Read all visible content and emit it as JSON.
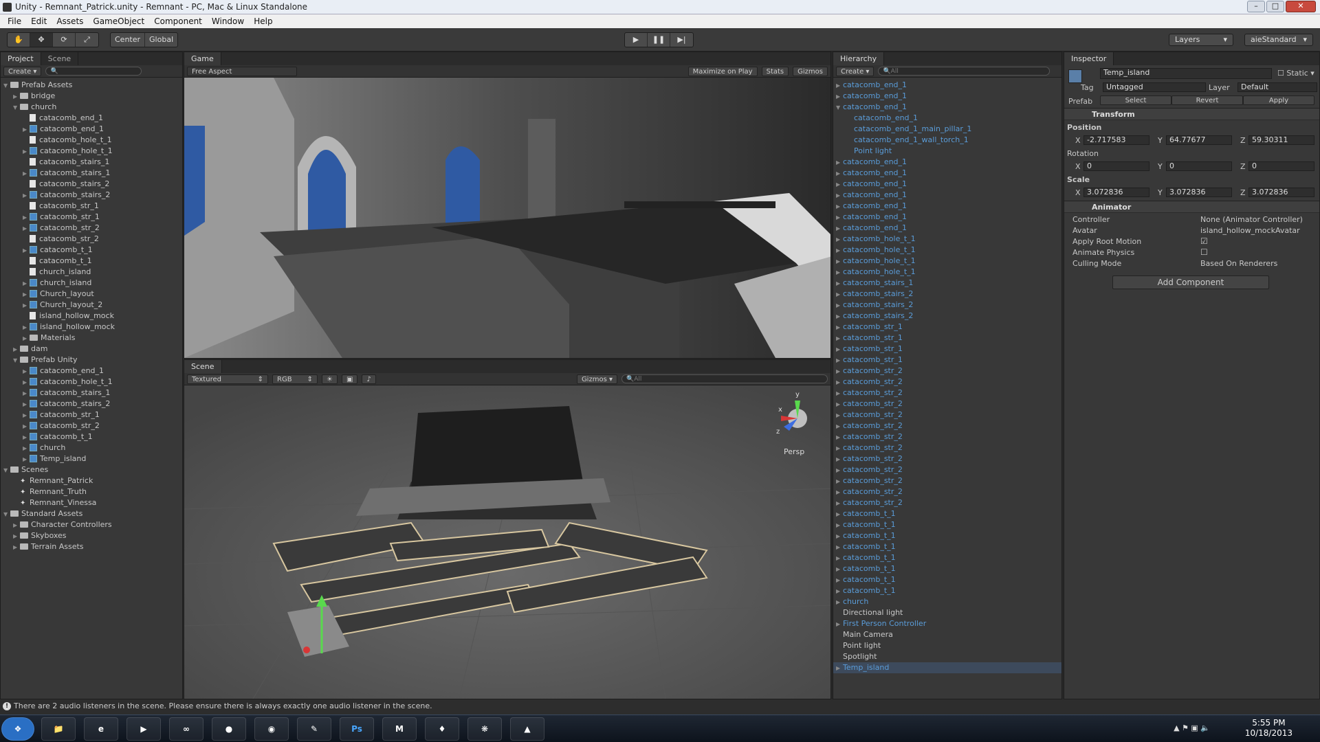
{
  "window": {
    "title": "Unity - Remnant_Patrick.unity - Remnant - PC, Mac & Linux Standalone"
  },
  "menu": [
    "File",
    "Edit",
    "Assets",
    "GameObject",
    "Component",
    "Window",
    "Help"
  ],
  "toolbar": {
    "tools": [
      "hand-tool",
      "move-tool",
      "rotate-tool",
      "scale-tool"
    ],
    "pivot": "Center",
    "space": "Global",
    "layers": "Layers",
    "layout": "aieStandard"
  },
  "project": {
    "tab_label": "Project",
    "scene_tab_label": "Scene",
    "create": "Create",
    "items": [
      {
        "label": "Prefab Assets",
        "depth": 0,
        "kind": "folder",
        "arrow": "down"
      },
      {
        "label": "bridge",
        "depth": 1,
        "kind": "folder",
        "arrow": "right"
      },
      {
        "label": "church",
        "depth": 1,
        "kind": "folder",
        "arrow": "down"
      },
      {
        "label": "catacomb_end_1",
        "depth": 2,
        "kind": "white",
        "arrow": ""
      },
      {
        "label": "catacomb_end_1",
        "depth": 2,
        "kind": "prefab",
        "arrow": "right"
      },
      {
        "label": "catacomb_hole_t_1",
        "depth": 2,
        "kind": "white",
        "arrow": ""
      },
      {
        "label": "catacomb_hole_t_1",
        "depth": 2,
        "kind": "prefab",
        "arrow": "right"
      },
      {
        "label": "catacomb_stairs_1",
        "depth": 2,
        "kind": "white",
        "arrow": ""
      },
      {
        "label": "catacomb_stairs_1",
        "depth": 2,
        "kind": "prefab",
        "arrow": "right"
      },
      {
        "label": "catacomb_stairs_2",
        "depth": 2,
        "kind": "white",
        "arrow": ""
      },
      {
        "label": "catacomb_stairs_2",
        "depth": 2,
        "kind": "prefab",
        "arrow": "right"
      },
      {
        "label": "catacomb_str_1",
        "depth": 2,
        "kind": "white",
        "arrow": ""
      },
      {
        "label": "catacomb_str_1",
        "depth": 2,
        "kind": "prefab",
        "arrow": "right"
      },
      {
        "label": "catacomb_str_2",
        "depth": 2,
        "kind": "prefab",
        "arrow": "right"
      },
      {
        "label": "catacomb_str_2",
        "depth": 2,
        "kind": "white",
        "arrow": ""
      },
      {
        "label": "catacomb_t_1",
        "depth": 2,
        "kind": "prefab",
        "arrow": "right"
      },
      {
        "label": "catacomb_t_1",
        "depth": 2,
        "kind": "white",
        "arrow": ""
      },
      {
        "label": "church_island",
        "depth": 2,
        "kind": "white",
        "arrow": ""
      },
      {
        "label": "church_island",
        "depth": 2,
        "kind": "prefab",
        "arrow": "right"
      },
      {
        "label": "Church_layout",
        "depth": 2,
        "kind": "prefab",
        "arrow": "right"
      },
      {
        "label": "Church_layout_2",
        "depth": 2,
        "kind": "prefab",
        "arrow": "right"
      },
      {
        "label": "island_hollow_mock",
        "depth": 2,
        "kind": "white",
        "arrow": ""
      },
      {
        "label": "island_hollow_mock",
        "depth": 2,
        "kind": "prefab",
        "arrow": "right"
      },
      {
        "label": "Materials",
        "depth": 2,
        "kind": "folder",
        "arrow": "right"
      },
      {
        "label": "dam",
        "depth": 1,
        "kind": "folder",
        "arrow": "right"
      },
      {
        "label": "Prefab Unity",
        "depth": 1,
        "kind": "folder",
        "arrow": "down"
      },
      {
        "label": "catacomb_end_1",
        "depth": 2,
        "kind": "prefab",
        "arrow": "right"
      },
      {
        "label": "catacomb_hole_t_1",
        "depth": 2,
        "kind": "prefab",
        "arrow": "right"
      },
      {
        "label": "catacomb_stairs_1",
        "depth": 2,
        "kind": "prefab",
        "arrow": "right"
      },
      {
        "label": "catacomb_stairs_2",
        "depth": 2,
        "kind": "prefab",
        "arrow": "right"
      },
      {
        "label": "catacomb_str_1",
        "depth": 2,
        "kind": "prefab",
        "arrow": "right"
      },
      {
        "label": "catacomb_str_2",
        "depth": 2,
        "kind": "prefab",
        "arrow": "right"
      },
      {
        "label": "catacomb_t_1",
        "depth": 2,
        "kind": "prefab",
        "arrow": "right"
      },
      {
        "label": "church",
        "depth": 2,
        "kind": "prefab",
        "arrow": "right"
      },
      {
        "label": "Temp_island",
        "depth": 2,
        "kind": "prefab",
        "arrow": "right"
      },
      {
        "label": "Scenes",
        "depth": 0,
        "kind": "folder",
        "arrow": "down"
      },
      {
        "label": "Remnant_Patrick",
        "depth": 1,
        "kind": "scene",
        "arrow": ""
      },
      {
        "label": "Remnant_Truth",
        "depth": 1,
        "kind": "scene",
        "arrow": ""
      },
      {
        "label": "Remnant_Vinessa",
        "depth": 1,
        "kind": "scene",
        "arrow": ""
      },
      {
        "label": "Standard Assets",
        "depth": 0,
        "kind": "folder",
        "arrow": "down"
      },
      {
        "label": "Character Controllers",
        "depth": 1,
        "kind": "folder",
        "arrow": "right"
      },
      {
        "label": "Skyboxes",
        "depth": 1,
        "kind": "folder",
        "arrow": "right"
      },
      {
        "label": "Terrain Assets",
        "depth": 1,
        "kind": "folder",
        "arrow": "right"
      }
    ]
  },
  "game": {
    "tab_label": "Game",
    "aspect": "Free Aspect",
    "maximize": "Maximize on Play",
    "stats": "Stats",
    "gizmos": "Gizmos"
  },
  "scene": {
    "tab_label": "Scene",
    "shading": "Textured",
    "render_mode": "RGB",
    "gizmos": "Gizmos",
    "search": "All",
    "persp": "Persp",
    "axis_y": "y",
    "axis_x": "x",
    "axis_z": "z"
  },
  "hierarchy": {
    "tab_label": "Hierarchy",
    "create": "Create",
    "search": "All",
    "items": [
      {
        "label": "catacomb_end_1",
        "depth": 0,
        "arrow": "right",
        "style": "prefab"
      },
      {
        "label": "catacomb_end_1",
        "depth": 0,
        "arrow": "right",
        "style": "prefab"
      },
      {
        "label": "catacomb_end_1",
        "depth": 0,
        "arrow": "down",
        "style": "prefab"
      },
      {
        "label": "catacomb_end_1",
        "depth": 1,
        "arrow": "",
        "style": "prefab"
      },
      {
        "label": "catacomb_end_1_main_pillar_1",
        "depth": 1,
        "arrow": "",
        "style": "prefab"
      },
      {
        "label": "catacomb_end_1_wall_torch_1",
        "depth": 1,
        "arrow": "",
        "style": "prefab"
      },
      {
        "label": "Point light",
        "depth": 1,
        "arrow": "",
        "style": "prefab"
      },
      {
        "label": "catacomb_end_1",
        "depth": 0,
        "arrow": "right",
        "style": "prefab"
      },
      {
        "label": "catacomb_end_1",
        "depth": 0,
        "arrow": "right",
        "style": "prefab"
      },
      {
        "label": "catacomb_end_1",
        "depth": 0,
        "arrow": "right",
        "style": "prefab"
      },
      {
        "label": "catacomb_end_1",
        "depth": 0,
        "arrow": "right",
        "style": "prefab"
      },
      {
        "label": "catacomb_end_1",
        "depth": 0,
        "arrow": "right",
        "style": "prefab"
      },
      {
        "label": "catacomb_end_1",
        "depth": 0,
        "arrow": "right",
        "style": "prefab"
      },
      {
        "label": "catacomb_end_1",
        "depth": 0,
        "arrow": "right",
        "style": "prefab"
      },
      {
        "label": "catacomb_hole_t_1",
        "depth": 0,
        "arrow": "right",
        "style": "prefab"
      },
      {
        "label": "catacomb_hole_t_1",
        "depth": 0,
        "arrow": "right",
        "style": "prefab"
      },
      {
        "label": "catacomb_hole_t_1",
        "depth": 0,
        "arrow": "right",
        "style": "prefab"
      },
      {
        "label": "catacomb_hole_t_1",
        "depth": 0,
        "arrow": "right",
        "style": "prefab"
      },
      {
        "label": "catacomb_stairs_1",
        "depth": 0,
        "arrow": "right",
        "style": "prefab"
      },
      {
        "label": "catacomb_stairs_2",
        "depth": 0,
        "arrow": "right",
        "style": "prefab"
      },
      {
        "label": "catacomb_stairs_2",
        "depth": 0,
        "arrow": "right",
        "style": "prefab"
      },
      {
        "label": "catacomb_stairs_2",
        "depth": 0,
        "arrow": "right",
        "style": "prefab"
      },
      {
        "label": "catacomb_str_1",
        "depth": 0,
        "arrow": "right",
        "style": "prefab"
      },
      {
        "label": "catacomb_str_1",
        "depth": 0,
        "arrow": "right",
        "style": "prefab"
      },
      {
        "label": "catacomb_str_1",
        "depth": 0,
        "arrow": "right",
        "style": "prefab"
      },
      {
        "label": "catacomb_str_1",
        "depth": 0,
        "arrow": "right",
        "style": "prefab"
      },
      {
        "label": "catacomb_str_2",
        "depth": 0,
        "arrow": "right",
        "style": "prefab"
      },
      {
        "label": "catacomb_str_2",
        "depth": 0,
        "arrow": "right",
        "style": "prefab"
      },
      {
        "label": "catacomb_str_2",
        "depth": 0,
        "arrow": "right",
        "style": "prefab"
      },
      {
        "label": "catacomb_str_2",
        "depth": 0,
        "arrow": "right",
        "style": "prefab"
      },
      {
        "label": "catacomb_str_2",
        "depth": 0,
        "arrow": "right",
        "style": "prefab"
      },
      {
        "label": "catacomb_str_2",
        "depth": 0,
        "arrow": "right",
        "style": "prefab"
      },
      {
        "label": "catacomb_str_2",
        "depth": 0,
        "arrow": "right",
        "style": "prefab"
      },
      {
        "label": "catacomb_str_2",
        "depth": 0,
        "arrow": "right",
        "style": "prefab"
      },
      {
        "label": "catacomb_str_2",
        "depth": 0,
        "arrow": "right",
        "style": "prefab"
      },
      {
        "label": "catacomb_str_2",
        "depth": 0,
        "arrow": "right",
        "style": "prefab"
      },
      {
        "label": "catacomb_str_2",
        "depth": 0,
        "arrow": "right",
        "style": "prefab"
      },
      {
        "label": "catacomb_str_2",
        "depth": 0,
        "arrow": "right",
        "style": "prefab"
      },
      {
        "label": "catacomb_str_2",
        "depth": 0,
        "arrow": "right",
        "style": "prefab"
      },
      {
        "label": "catacomb_t_1",
        "depth": 0,
        "arrow": "right",
        "style": "prefab"
      },
      {
        "label": "catacomb_t_1",
        "depth": 0,
        "arrow": "right",
        "style": "prefab"
      },
      {
        "label": "catacomb_t_1",
        "depth": 0,
        "arrow": "right",
        "style": "prefab"
      },
      {
        "label": "catacomb_t_1",
        "depth": 0,
        "arrow": "right",
        "style": "prefab"
      },
      {
        "label": "catacomb_t_1",
        "depth": 0,
        "arrow": "right",
        "style": "prefab"
      },
      {
        "label": "catacomb_t_1",
        "depth": 0,
        "arrow": "right",
        "style": "prefab"
      },
      {
        "label": "catacomb_t_1",
        "depth": 0,
        "arrow": "right",
        "style": "prefab"
      },
      {
        "label": "catacomb_t_1",
        "depth": 0,
        "arrow": "right",
        "style": "prefab"
      },
      {
        "label": "church",
        "depth": 0,
        "arrow": "right",
        "style": "prefab"
      },
      {
        "label": "Directional light",
        "depth": 0,
        "arrow": "",
        "style": "plain"
      },
      {
        "label": "First Person Controller",
        "depth": 0,
        "arrow": "right",
        "style": "prefab"
      },
      {
        "label": "Main Camera",
        "depth": 0,
        "arrow": "",
        "style": "plain"
      },
      {
        "label": "Point light",
        "depth": 0,
        "arrow": "",
        "style": "plain"
      },
      {
        "label": "Spotlight",
        "depth": 0,
        "arrow": "",
        "style": "plain"
      },
      {
        "label": "Temp_island",
        "depth": 0,
        "arrow": "right",
        "style": "selected"
      }
    ]
  },
  "inspector": {
    "tab_label": "Inspector",
    "object_name": "Temp_island",
    "static_label": "Static",
    "tag_label": "Tag",
    "tag_value": "Untagged",
    "layer_label": "Layer",
    "layer_value": "Default",
    "prefab_label": "Prefab",
    "prefab_select": "Select",
    "prefab_revert": "Revert",
    "prefab_apply": "Apply",
    "transform": {
      "title": "Transform",
      "position_label": "Position",
      "rotation_label": "Rotation",
      "scale_label": "Scale",
      "position": {
        "x": "-2.717583",
        "y": "64.77677",
        "z": "59.30311"
      },
      "rotation": {
        "x": "0",
        "y": "0",
        "z": "0"
      },
      "scale": {
        "x": "3.072836",
        "y": "3.072836",
        "z": "3.072836"
      }
    },
    "animator": {
      "title": "Animator",
      "enabled": true,
      "controller_label": "Controller",
      "controller_value": "None (Animator Controller)",
      "avatar_label": "Avatar",
      "avatar_value": "island_hollow_mockAvatar",
      "apply_root_motion_label": "Apply Root Motion",
      "apply_root_motion": true,
      "animate_physics_label": "Animate Physics",
      "animate_physics": false,
      "culling_label": "Culling Mode",
      "culling_value": "Based On Renderers"
    },
    "add_component": "Add Component"
  },
  "status": {
    "message": "There are 2 audio listeners in the scene. Please ensure there is always exactly one audio listener in the scene."
  },
  "taskbar": {
    "apps": [
      "start-orb",
      "explorer-icon",
      "ie-icon",
      "media-player-icon",
      "link-icon",
      "chrome-icon",
      "app-icon",
      "paint-icon",
      "photoshop-icon",
      "maya-icon",
      "mudbox-icon",
      "colors-icon",
      "unity-icon"
    ],
    "ps_label": "Ps",
    "time": "5:55 PM",
    "date": "10/18/2013"
  },
  "colors": {
    "accent": "#3d4a5c",
    "prefab_text": "#5a9cd8",
    "panel": "#383838"
  }
}
